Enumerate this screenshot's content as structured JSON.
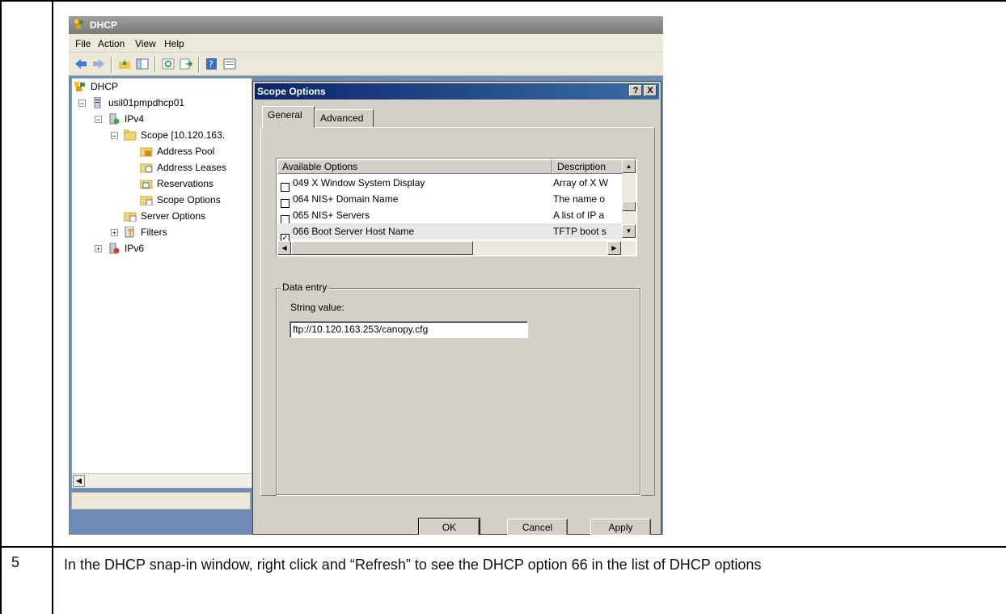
{
  "mmc": {
    "title": "DHCP",
    "menu": [
      "File",
      "Action",
      "View",
      "Help"
    ],
    "tree": {
      "root": "DHCP",
      "server": "usil01pmpdhcp01",
      "ipv4": "IPv4",
      "scope": "Scope [10.120.163.",
      "address_pool": "Address Pool",
      "address_leases": "Address Leases",
      "reservations": "Reservations",
      "scope_options": "Scope Options",
      "server_options": "Server Options",
      "filters": "Filters",
      "ipv6": "IPv6"
    }
  },
  "dialog": {
    "title": "Scope Options",
    "help_glyph": "?",
    "close_glyph": "X",
    "tabs": [
      "General",
      "Advanced"
    ],
    "columns": [
      "Available Options",
      "Description"
    ],
    "options": [
      {
        "name": "049 X Window System Display",
        "desc": "Array of X W",
        "checked": false
      },
      {
        "name": "064 NIS+ Domain Name",
        "desc": "The name o",
        "checked": false
      },
      {
        "name": "065 NIS+ Servers",
        "desc": "A list of IP a",
        "checked": false
      },
      {
        "name": "066 Boot Server Host Name",
        "desc": "TFTP boot s",
        "checked": true
      }
    ],
    "data_entry_label": "Data entry",
    "string_value_label": "String value:",
    "string_value": "ftp://10.120.163.253/canopy.cfg",
    "buttons": {
      "ok": "OK",
      "cancel": "Cancel",
      "apply": "Apply"
    }
  },
  "step": {
    "number": "5",
    "text": "In the DHCP snap-in window, right click and “Refresh” to see the DHCP option 66 in the list of DHCP options"
  }
}
